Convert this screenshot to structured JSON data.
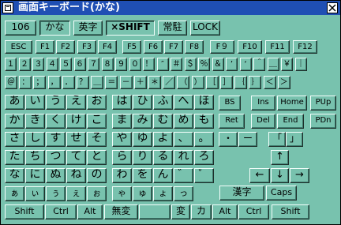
{
  "window": {
    "title": "画面キーボード(かな)"
  },
  "toolbar": [
    {
      "name": "mode-106-button",
      "label": "106"
    },
    {
      "name": "mode-kana-button",
      "label": "かな",
      "pressed": true
    },
    {
      "name": "mode-eiji-button",
      "label": "英字"
    },
    {
      "name": "shift-lock-button",
      "label": "×SHIFT",
      "pressed": true,
      "bold": true
    },
    {
      "name": "resident-button",
      "label": "常駐"
    },
    {
      "name": "lock-button",
      "label": "LOCK"
    }
  ],
  "function_row": [
    "ESC",
    "F1",
    "F2",
    "F3",
    "F4",
    "F5",
    "F6",
    "F7",
    "F8",
    "F９",
    "F10",
    "F11",
    "F12"
  ],
  "number_row": [
    "１",
    "２",
    "３",
    "４",
    "５",
    "６",
    "７",
    "８",
    "９",
    "０",
    "！",
    "″",
    "＃",
    "＄",
    "％",
    "＆",
    "’",
    "‘",
    "＾",
    "＿",
    "￥",
    "｜"
  ],
  "symbol_row": [
    "＠",
    "：",
    "；",
    "，",
    "．",
    "？",
    "＿",
    "＝",
    "－",
    "＋",
    "＊",
    "／",
    "（",
    "）",
    "［",
    "］",
    "｛",
    "｝",
    "＜",
    "＞"
  ],
  "kana_rows": [
    [
      "あ",
      "い",
      "う",
      "え",
      "お",
      "は",
      "ひ",
      "ふ",
      "へ",
      "ほ"
    ],
    [
      "か",
      "き",
      "く",
      "け",
      "こ",
      "ま",
      "み",
      "む",
      "め",
      "も"
    ],
    [
      "さ",
      "し",
      "す",
      "せ",
      "そ",
      "や",
      "ゆ",
      "よ",
      "、",
      "。"
    ],
    [
      "た",
      "ち",
      "つ",
      "て",
      "と",
      "ら",
      "り",
      "る",
      "れ",
      "ろ"
    ],
    [
      "な",
      "に",
      "ぬ",
      "ね",
      "の",
      "わ",
      "を",
      "ん",
      "゛",
      "゜"
    ],
    [
      "ぁ",
      "ぃ",
      "ぅ",
      "ぇ",
      "ぉ",
      "ゃ",
      "ゅ",
      "ょ",
      "っ"
    ]
  ],
  "edit_keys": {
    "bs": "BS",
    "ins": "Ins",
    "home": "Home",
    "pup": "PUp",
    "ret": "Ret",
    "del": "Del",
    "end": "End",
    "pdn": "PDn"
  },
  "extra_keys": {
    "dot": "・",
    "dash": "ー",
    "bracket_open": "「",
    "bracket_close": "」"
  },
  "arrows": {
    "up": "↑",
    "left": "←",
    "down": "↓",
    "right": "→"
  },
  "bottom_keys": {
    "kanji": "漢字",
    "caps": "Caps",
    "shift_l": "Shift",
    "ctrl_l": "Ctrl",
    "alt_l": "Alt",
    "muhenkan": "無変",
    "henkan": "変",
    "kana": "カ",
    "alt_r": "Alt",
    "ctrl_r": "Ctrl",
    "shift_r": "Shift"
  }
}
